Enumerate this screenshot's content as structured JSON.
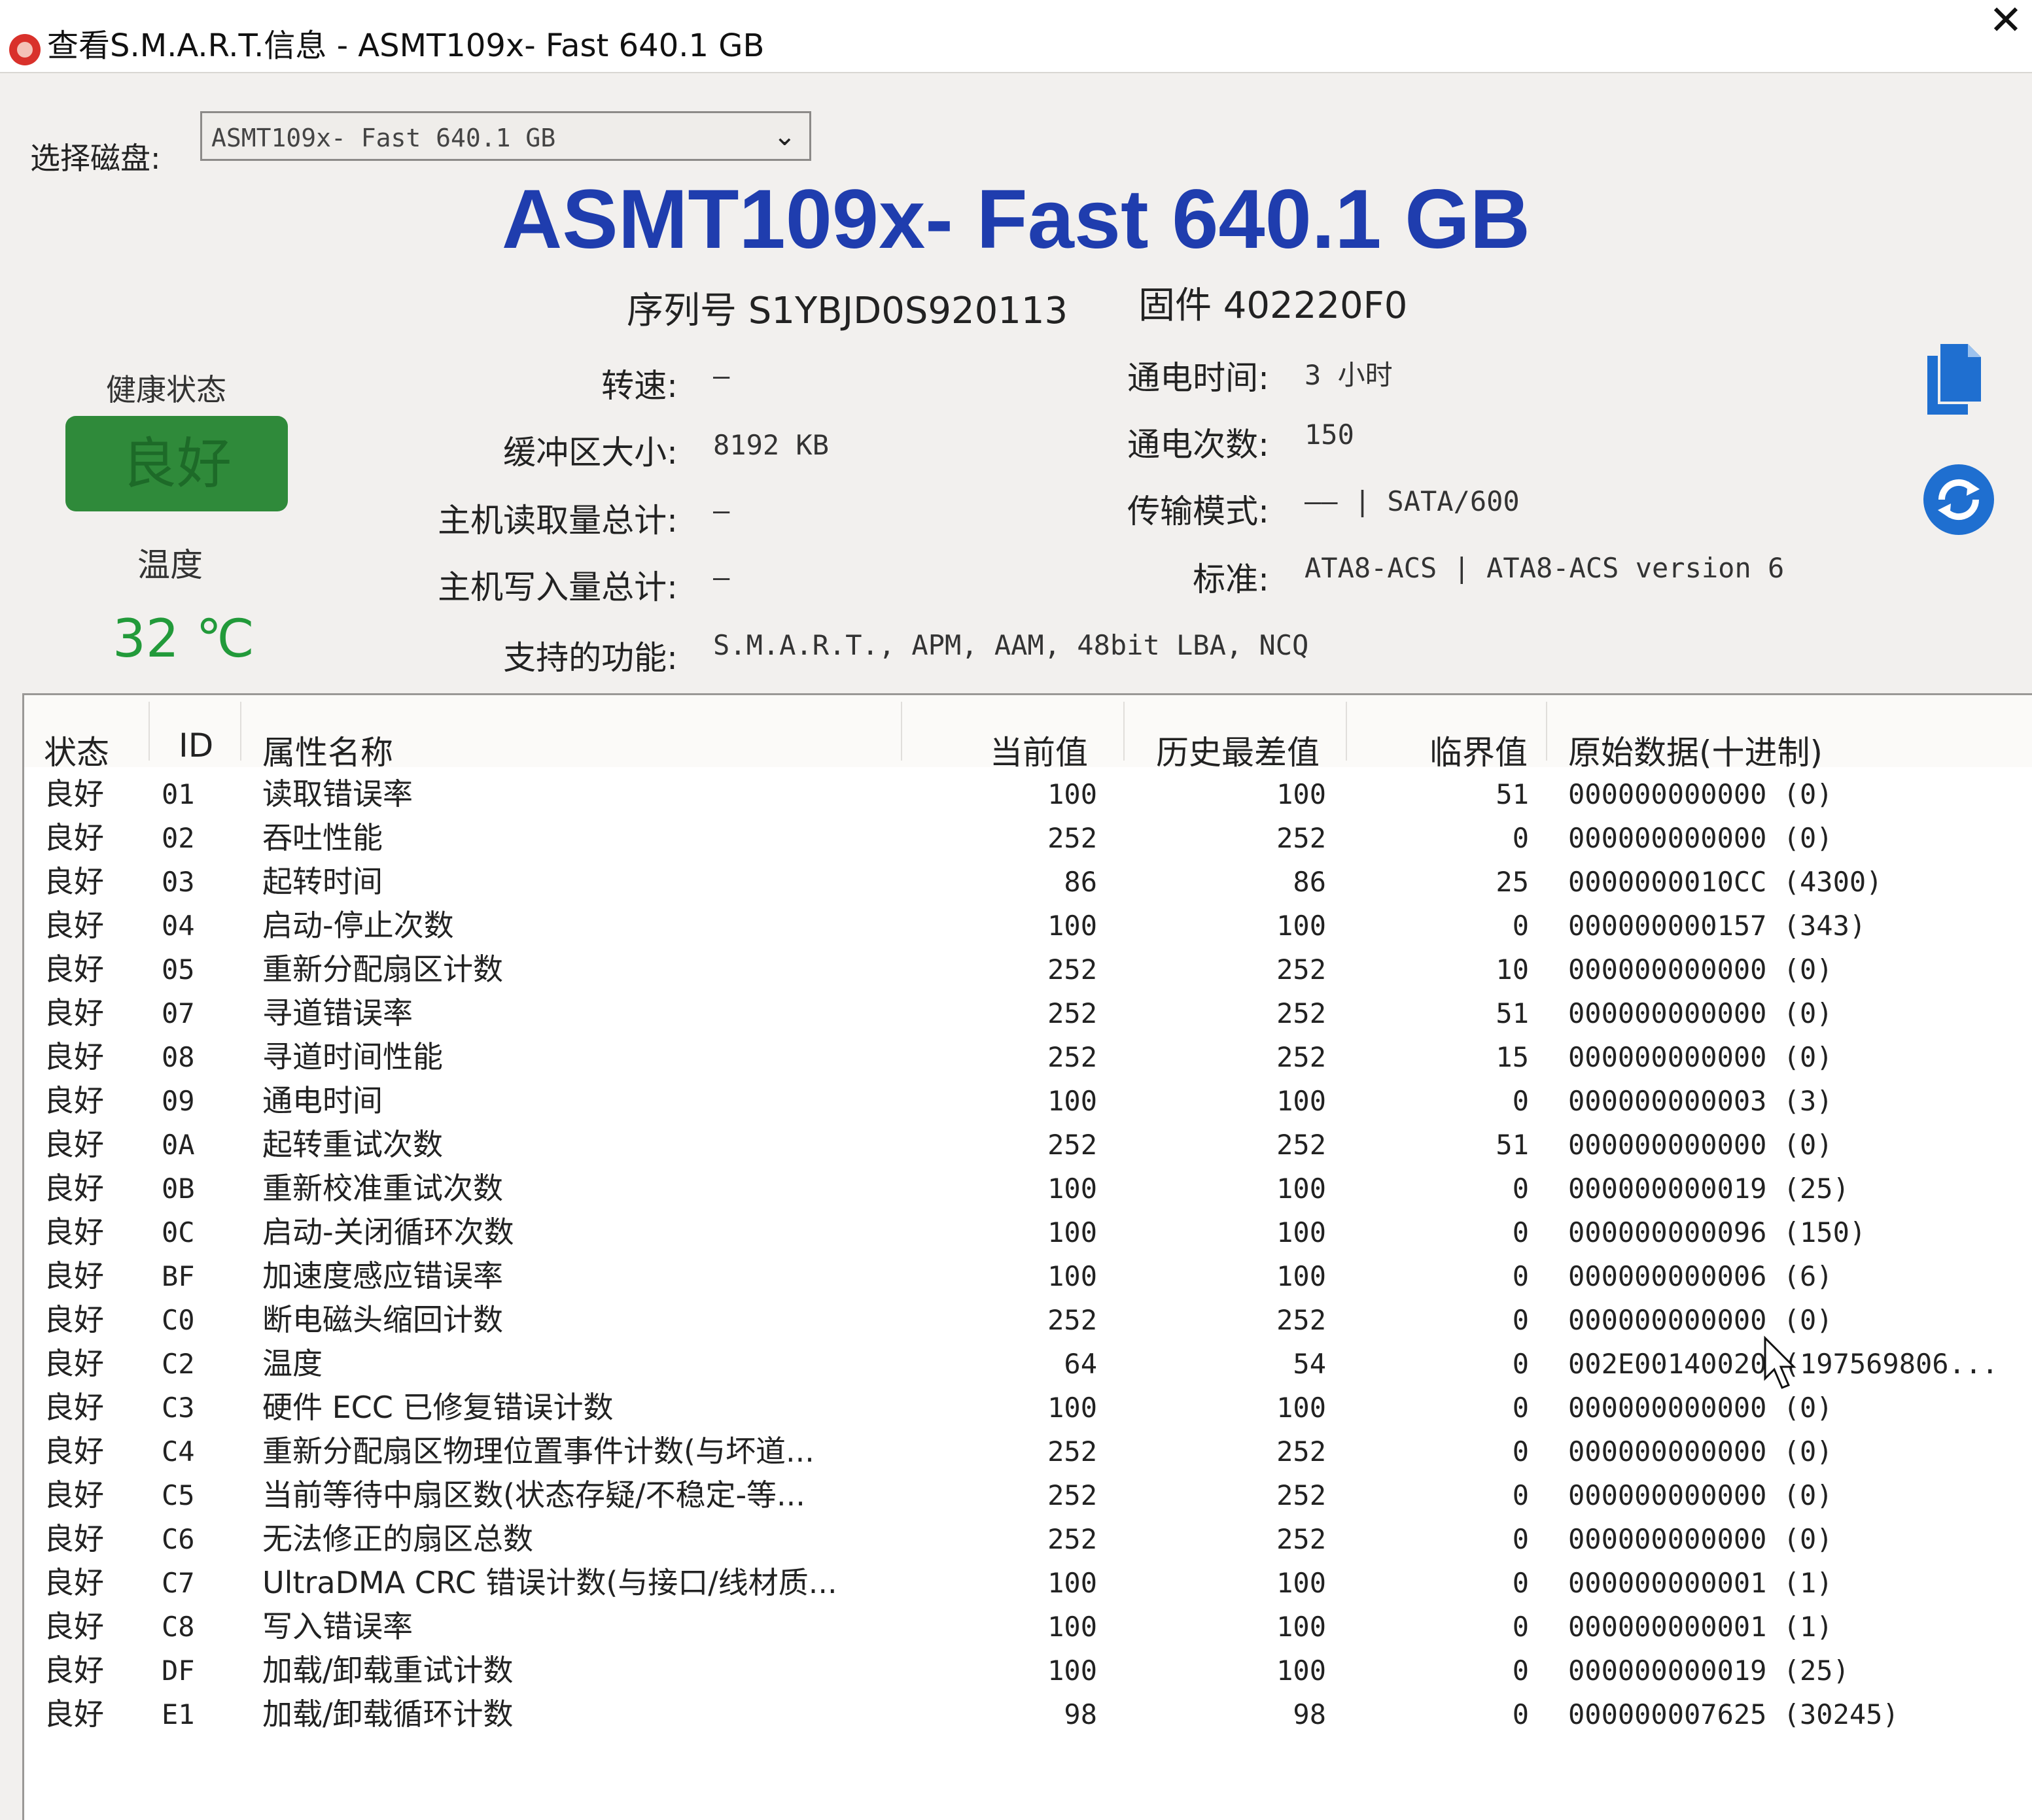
{
  "window": {
    "title": "查看S.M.A.R.T.信息 - ASMT109x- Fast 640.1 GB",
    "close_glyph": "✕"
  },
  "disk_select": {
    "label": "选择磁盘:",
    "value": "ASMT109x- Fast 640.1 GB"
  },
  "drive": {
    "name": "ASMT109x- Fast 640.1 GB",
    "serial": "序列号 S1YBJD0S920113",
    "firmware": "固件 402220F0"
  },
  "health": {
    "title": "健康状态",
    "status": "良好",
    "temp_title": "温度",
    "temp_value": "32 ℃"
  },
  "info": {
    "rpm_label": "转速:",
    "rpm_value": "—",
    "buffer_label": "缓冲区大小:",
    "buffer_value": "8192 KB",
    "host_read_label": "主机读取量总计:",
    "host_read_value": "—",
    "host_write_label": "主机写入量总计:",
    "host_write_value": "—",
    "features_label": "支持的功能:",
    "features_value": "S.M.A.R.T., APM, AAM, 48bit LBA, NCQ",
    "power_on_hours_label": "通电时间:",
    "power_on_hours_value": "3 小时",
    "power_on_count_label": "通电次数:",
    "power_on_count_value": "150",
    "transfer_label": "传输模式:",
    "transfer_value": "—— | SATA/600",
    "standard_label": "标准:",
    "standard_value": "ATA8-ACS | ATA8-ACS version 6"
  },
  "icons": {
    "copy": "copy-icon",
    "refresh": "refresh-icon",
    "dropdown": "chevron-down-icon",
    "cursor": "mouse-cursor-icon"
  },
  "colors": {
    "title_blue": "#1f3dae",
    "health_green": "#2f8a3a",
    "temp_green": "#229a3a",
    "icon_blue": "#1f6fd0"
  },
  "table": {
    "headers": {
      "status": "状态",
      "id": "ID",
      "name": "属性名称",
      "current": "当前值",
      "worst": "历史最差值",
      "threshold": "临界值",
      "raw": "原始数据(十进制)"
    },
    "rows": [
      {
        "status": "良好",
        "id": "01",
        "name": "读取错误率",
        "current": "100",
        "worst": "100",
        "threshold": "51",
        "raw": "000000000000 (0)"
      },
      {
        "status": "良好",
        "id": "02",
        "name": "吞吐性能",
        "current": "252",
        "worst": "252",
        "threshold": "0",
        "raw": "000000000000 (0)"
      },
      {
        "status": "良好",
        "id": "03",
        "name": "起转时间",
        "current": "86",
        "worst": "86",
        "threshold": "25",
        "raw": "0000000010CC (4300)"
      },
      {
        "status": "良好",
        "id": "04",
        "name": "启动-停止次数",
        "current": "100",
        "worst": "100",
        "threshold": "0",
        "raw": "000000000157 (343)"
      },
      {
        "status": "良好",
        "id": "05",
        "name": "重新分配扇区计数",
        "current": "252",
        "worst": "252",
        "threshold": "10",
        "raw": "000000000000 (0)"
      },
      {
        "status": "良好",
        "id": "07",
        "name": "寻道错误率",
        "current": "252",
        "worst": "252",
        "threshold": "51",
        "raw": "000000000000 (0)"
      },
      {
        "status": "良好",
        "id": "08",
        "name": "寻道时间性能",
        "current": "252",
        "worst": "252",
        "threshold": "15",
        "raw": "000000000000 (0)"
      },
      {
        "status": "良好",
        "id": "09",
        "name": "通电时间",
        "current": "100",
        "worst": "100",
        "threshold": "0",
        "raw": "000000000003 (3)"
      },
      {
        "status": "良好",
        "id": "0A",
        "name": "起转重试次数",
        "current": "252",
        "worst": "252",
        "threshold": "51",
        "raw": "000000000000 (0)"
      },
      {
        "status": "良好",
        "id": "0B",
        "name": "重新校准重试次数",
        "current": "100",
        "worst": "100",
        "threshold": "0",
        "raw": "000000000019 (25)"
      },
      {
        "status": "良好",
        "id": "0C",
        "name": "启动-关闭循环次数",
        "current": "100",
        "worst": "100",
        "threshold": "0",
        "raw": "000000000096 (150)"
      },
      {
        "status": "良好",
        "id": "BF",
        "name": "加速度感应错误率",
        "current": "100",
        "worst": "100",
        "threshold": "0",
        "raw": "000000000006 (6)"
      },
      {
        "status": "良好",
        "id": "C0",
        "name": "断电磁头缩回计数",
        "current": "252",
        "worst": "252",
        "threshold": "0",
        "raw": "000000000000 (0)"
      },
      {
        "status": "良好",
        "id": "C2",
        "name": "温度",
        "current": "64",
        "worst": "54",
        "threshold": "0",
        "raw": "002E00140020 (197569806..."
      },
      {
        "status": "良好",
        "id": "C3",
        "name": "硬件 ECC 已修复错误计数",
        "current": "100",
        "worst": "100",
        "threshold": "0",
        "raw": "000000000000 (0)"
      },
      {
        "status": "良好",
        "id": "C4",
        "name": "重新分配扇区物理位置事件计数(与坏道...",
        "current": "252",
        "worst": "252",
        "threshold": "0",
        "raw": "000000000000 (0)"
      },
      {
        "status": "良好",
        "id": "C5",
        "name": "当前等待中扇区数(状态存疑/不稳定-等...",
        "current": "252",
        "worst": "252",
        "threshold": "0",
        "raw": "000000000000 (0)"
      },
      {
        "status": "良好",
        "id": "C6",
        "name": "无法修正的扇区总数",
        "current": "252",
        "worst": "252",
        "threshold": "0",
        "raw": "000000000000 (0)"
      },
      {
        "status": "良好",
        "id": "C7",
        "name": "UltraDMA CRC 错误计数(与接口/线材质...",
        "current": "100",
        "worst": "100",
        "threshold": "0",
        "raw": "000000000001 (1)"
      },
      {
        "status": "良好",
        "id": "C8",
        "name": "写入错误率",
        "current": "100",
        "worst": "100",
        "threshold": "0",
        "raw": "000000000001 (1)"
      },
      {
        "status": "良好",
        "id": "DF",
        "name": "加载/卸载重试计数",
        "current": "100",
        "worst": "100",
        "threshold": "0",
        "raw": "000000000019 (25)"
      },
      {
        "status": "良好",
        "id": "E1",
        "name": "加载/卸载循环计数",
        "current": "98",
        "worst": "98",
        "threshold": "0",
        "raw": "000000007625 (30245)"
      }
    ]
  }
}
